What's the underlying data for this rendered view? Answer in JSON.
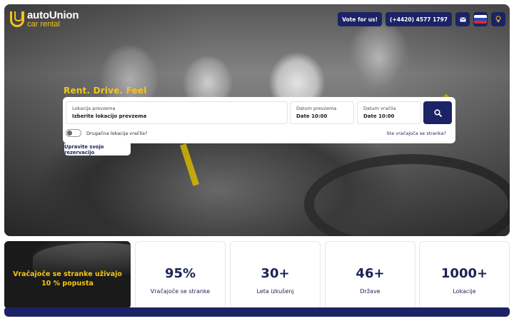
{
  "brand": {
    "name": "autoUnion",
    "tagline_sub": "car rental",
    "primary_color": "#1b2366",
    "accent_color": "#f5c518"
  },
  "topbar": {
    "vote_label": "Vote for us!",
    "phone_label": "(+4420) 4577 1797",
    "mail_icon": "mail-icon",
    "language_flag": "slovenia-flag",
    "theme_icon": "lightbulb-icon"
  },
  "hero": {
    "slogan": "Rent. Drive. Feel"
  },
  "search": {
    "pickup_label": "Lokacija prevzema",
    "pickup_value": "Izberite lokacijo prevzema",
    "pickup_date_label": "Datum prevzema",
    "pickup_date_value": "Date 10:00",
    "return_date_label": "Datum vračila",
    "return_date_value": "Date 10:00",
    "search_icon": "search-icon",
    "different_return_label": "Drugačna lokacija vračila?",
    "different_return_checked": false,
    "returning_customer_link": "Ste vračajoča se stranka?",
    "manage_booking_label": "Upravite svojo rezervacijo"
  },
  "promo": {
    "text": "Vračajoče se stranke uživajo 10 % popusta"
  },
  "stats": [
    {
      "value": "95%",
      "label": "Vračajoče se stranke"
    },
    {
      "value": "30+",
      "label": "Leta izkušenj"
    },
    {
      "value": "46+",
      "label": "Države"
    },
    {
      "value": "1000+",
      "label": "Lokacije"
    }
  ]
}
